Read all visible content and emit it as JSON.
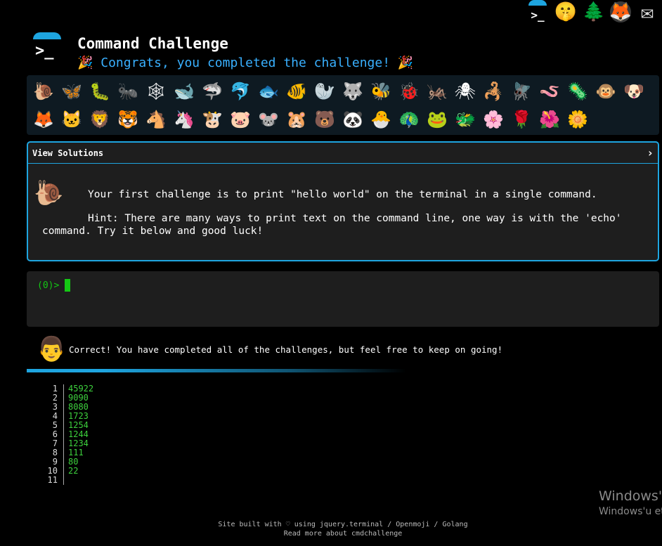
{
  "header": {
    "title": "Command Challenge",
    "congrats": "🎉 Congrats, you completed the challenge! 🎉",
    "logo_prompt": ">_"
  },
  "top_icons": {
    "term_prompt": ">_",
    "shush": "🤫",
    "tree": "🌲",
    "gitlab": "🦊",
    "mail": "✉"
  },
  "emojis": [
    "🐌",
    "🦋",
    "🐛",
    "🐜",
    "🕸",
    "🐋",
    "🦈",
    "🐬",
    "🐟",
    "🐠",
    "🦭",
    "🐺",
    "🐝",
    "🐞",
    "🦗",
    "🕷",
    "🦂",
    "🪰",
    "🪱",
    "🦠",
    "🐵",
    "🐶",
    "🦊",
    "🐱",
    "🦁",
    "🐯",
    "🐴",
    "🦄",
    "🐮",
    "🐷",
    "🐭",
    "🐹",
    "🐻",
    "🐼",
    "🐣",
    "🦚",
    "🐸",
    "🐲",
    "🌸",
    "🌹",
    "🌺",
    "🌼"
  ],
  "solutions": {
    "label": "View Solutions",
    "chevron": "›",
    "intro_icon": "🐌",
    "line1": "Your first challenge is to print \"hello world\" on the terminal in a single command.",
    "line2": "Hint: There are many ways to print text on the command line, one way is with the 'echo' command. Try it below and good luck!"
  },
  "terminal": {
    "prompt": "(0)>"
  },
  "success": {
    "avatar": "👨",
    "message": "Correct! You have completed all of the challenges, but feel free to keep on going!"
  },
  "listing": {
    "rows": [
      {
        "n": "1",
        "v": "45922"
      },
      {
        "n": "2",
        "v": "9090"
      },
      {
        "n": "3",
        "v": "8080"
      },
      {
        "n": "4",
        "v": "1723"
      },
      {
        "n": "5",
        "v": "1254"
      },
      {
        "n": "6",
        "v": "1244"
      },
      {
        "n": "7",
        "v": "1234"
      },
      {
        "n": "8",
        "v": "111"
      },
      {
        "n": "9",
        "v": "80"
      },
      {
        "n": "10",
        "v": "22"
      },
      {
        "n": "11",
        "v": ""
      }
    ]
  },
  "watermark": {
    "line1": "Windows'u",
    "line2": "Windows'u et"
  },
  "footer": {
    "line1": "Site built with ♡ using jquery.terminal / Openmoji / Golang",
    "line2": "Read more about cmdchallenge"
  }
}
